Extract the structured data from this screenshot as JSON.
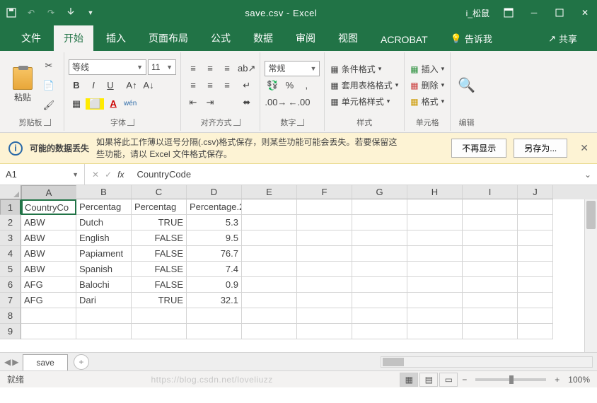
{
  "title": {
    "filename": "save.csv",
    "sep": " - ",
    "app": "Excel",
    "user": "i_松鼠"
  },
  "tabs": [
    "文件",
    "开始",
    "插入",
    "页面布局",
    "公式",
    "数据",
    "审阅",
    "视图",
    "ACROBAT"
  ],
  "tell_me": "告诉我",
  "share": "共享",
  "ribbon": {
    "clipboard": {
      "paste": "粘贴",
      "label": "剪贴板"
    },
    "font": {
      "name": "等线",
      "size": "11",
      "wen": "wén",
      "label": "字体"
    },
    "align": {
      "label": "对齐方式"
    },
    "number": {
      "format": "常规",
      "label": "数字"
    },
    "styles": {
      "cond": "条件格式",
      "table": "套用表格格式",
      "cell": "单元格样式",
      "label": "样式"
    },
    "cells": {
      "insert": "插入",
      "delete": "删除",
      "format": "格式",
      "label": "单元格"
    },
    "edit": {
      "label": "编辑"
    }
  },
  "warn": {
    "title": "可能的数据丢失",
    "text": "如果将此工作薄以逗号分隔(.csv)格式保存，则某些功能可能会丢失。若要保留这些功能，请以 Excel 文件格式保存。",
    "dismiss": "不再显示",
    "saveas": "另存为..."
  },
  "namebox": "A1",
  "formula_value": "CountryCode",
  "columns": [
    "A",
    "B",
    "C",
    "D",
    "E",
    "F",
    "G",
    "H",
    "I",
    "J"
  ],
  "sheet_data": {
    "headers": [
      "CountryCode",
      "Percentage",
      "Percentage",
      "Percentage.2"
    ],
    "rows": [
      {
        "a": "ABW",
        "b": "Dutch",
        "c": "TRUE",
        "d": "5.3"
      },
      {
        "a": "ABW",
        "b": "English",
        "c": "FALSE",
        "d": "9.5"
      },
      {
        "a": "ABW",
        "b": "Papiamento",
        "c": "FALSE",
        "d": "76.7"
      },
      {
        "a": "ABW",
        "b": "Spanish",
        "c": "FALSE",
        "d": "7.4"
      },
      {
        "a": "AFG",
        "b": "Balochi",
        "c": "FALSE",
        "d": "0.9"
      },
      {
        "a": "AFG",
        "b": "Dari",
        "c": "TRUE",
        "d": "32.1"
      }
    ]
  },
  "sheet_tab": "save",
  "status": {
    "ready": "就绪",
    "zoom": "100%",
    "watermark": "https://blog.csdn.net/loveliuzz"
  }
}
